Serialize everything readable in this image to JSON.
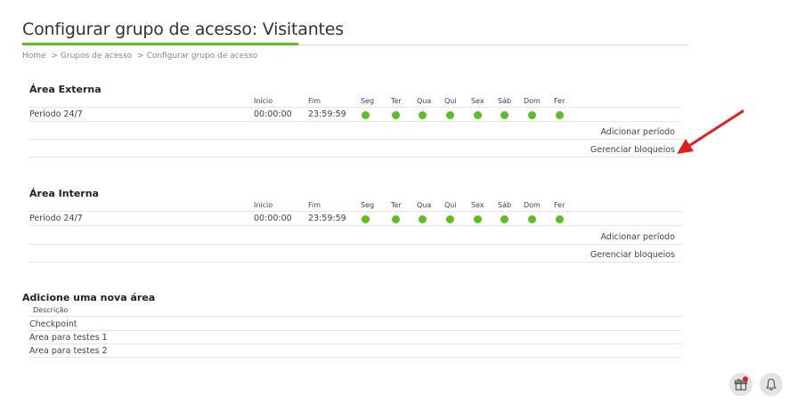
{
  "page": {
    "title": "Configurar grupo de acesso: Visitantes"
  },
  "breadcrumb": [
    "Home",
    "Grupos de acesso",
    "Configurar grupo de acesso"
  ],
  "breadcrumb_sep": ">",
  "schedule_headers": {
    "start": "Inicio",
    "end": "Fim",
    "days": [
      "Seg",
      "Ter",
      "Qua",
      "Qui",
      "Sex",
      "Sáb",
      "Dom",
      "Fer"
    ]
  },
  "areas": [
    {
      "name": "Área Externa",
      "periods": [
        {
          "name": "Período 24/7",
          "start": "00:00:00",
          "end": "23:59:59",
          "days_active": [
            true,
            true,
            true,
            true,
            true,
            true,
            true,
            true
          ]
        }
      ],
      "add_period_label": "Adicionar período",
      "manage_blocks_label": "Gerenciar bloqueios"
    },
    {
      "name": "Área Interna",
      "periods": [
        {
          "name": "Período 24/7",
          "start": "00:00:00",
          "end": "23:59:59",
          "days_active": [
            true,
            true,
            true,
            true,
            true,
            true,
            true,
            true
          ]
        }
      ],
      "add_period_label": "Adicionar período",
      "manage_blocks_label": "Gerenciar bloqueios"
    }
  ],
  "add_area": {
    "title": "Adicione uma nova área",
    "column_header": "Descrição",
    "items": [
      "Checkpoint",
      "Area para testes 1",
      "Area para testes 2"
    ]
  },
  "floating_buttons": [
    {
      "icon": "gift-notification-icon",
      "has_badge": true
    },
    {
      "icon": "bell-icon",
      "has_badge": false
    }
  ],
  "colors": {
    "accent": "#5bbf21",
    "active_day": "#5bbf21",
    "badge": "#e02020",
    "annotation_arrow": "#e02020"
  }
}
